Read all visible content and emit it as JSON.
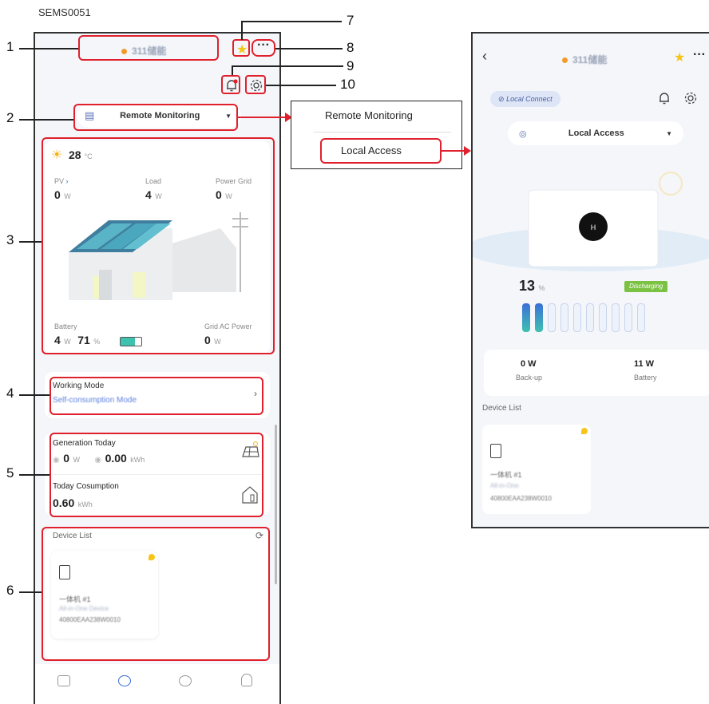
{
  "doc_code": "SEMS0051",
  "callouts": [
    "1",
    "2",
    "3",
    "4",
    "5",
    "6",
    "7",
    "8",
    "9",
    "10"
  ],
  "left_phone": {
    "plant_name": "311储能",
    "monitor_select": "Remote Monitoring",
    "weather": {
      "temp": "28",
      "unit": "°C"
    },
    "pv": {
      "label": "PV",
      "value": "0",
      "unit": "W"
    },
    "load": {
      "label": "Load",
      "value": "4",
      "unit": "W"
    },
    "grid": {
      "label": "Power Grid",
      "value": "0",
      "unit": "W"
    },
    "battery": {
      "label": "Battery",
      "power": "4",
      "power_unit": "W",
      "soc": "71",
      "soc_unit": "%",
      "level": 0.71
    },
    "grid_ac": {
      "label": "Grid AC Power",
      "value": "0",
      "unit": "W"
    },
    "working_mode": {
      "label": "Working Mode",
      "value": "Self-consumption Mode"
    },
    "generation": {
      "label": "Generation Today",
      "power": "0",
      "power_unit": "W",
      "energy": "0.00",
      "energy_unit": "kWh"
    },
    "consumption": {
      "label": "Today Cosumption",
      "value": "0.60",
      "unit": "kWh"
    },
    "device_list": {
      "title": "Device List",
      "device": {
        "name": "一体机 #1",
        "type": "All-in-One Device",
        "sn": "40800EAA238W0010"
      }
    }
  },
  "dropdown_menu": {
    "options": [
      "Remote Monitoring",
      "Local Access"
    ]
  },
  "right_phone": {
    "plant_name": "311储能",
    "local_connect": "Local Connect",
    "access_select": "Local Access",
    "soc": "13",
    "soc_unit": "%",
    "status": "Discharging",
    "bars_total": 10,
    "bars_filled": 2,
    "backup": {
      "value": "0 W",
      "label": "Back-up"
    },
    "battery": {
      "value": "11 W",
      "label": "Battery"
    },
    "device_list": {
      "title": "Device List",
      "device": {
        "name": "一体机 #1",
        "type": "All-in-One",
        "sn": "40800EAA238W0010"
      }
    }
  },
  "colors": {
    "accent_red": "#e0202c",
    "status_green": "#7cc242",
    "battery_teal": "#3fc1b0",
    "battery_blue": "#3b6fd9",
    "star": "#f5c518"
  }
}
